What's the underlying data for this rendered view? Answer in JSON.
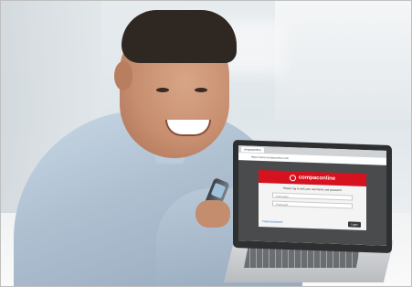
{
  "photo": {
    "subject": "smiling-man-with-laptop-and-phone"
  },
  "laptop_screen": {
    "browser_tab": "compaconline",
    "address": "https://www.compaconline.com",
    "brand_name": "compaconline",
    "prompt": "Please log in with your username and password",
    "username_placeholder": "Username",
    "password_placeholder": "Password",
    "forgot_link": "Forgot password",
    "login_button": "Login"
  },
  "colors": {
    "brand_red": "#d6121f",
    "screen_dark": "#4a4b4d"
  }
}
